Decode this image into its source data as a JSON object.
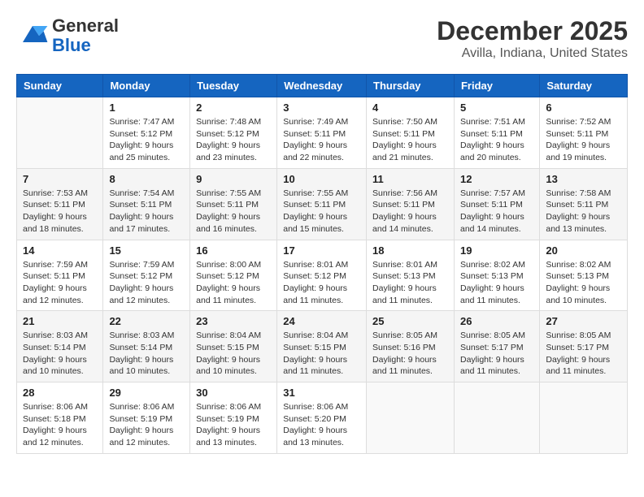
{
  "logo": {
    "line1": "General",
    "line2": "Blue"
  },
  "header": {
    "month": "December 2025",
    "location": "Avilla, Indiana, United States"
  },
  "days_of_week": [
    "Sunday",
    "Monday",
    "Tuesday",
    "Wednesday",
    "Thursday",
    "Friday",
    "Saturday"
  ],
  "weeks": [
    [
      {
        "day": "",
        "sunrise": "",
        "sunset": "",
        "daylight": ""
      },
      {
        "day": "1",
        "sunrise": "Sunrise: 7:47 AM",
        "sunset": "Sunset: 5:12 PM",
        "daylight": "Daylight: 9 hours and 25 minutes."
      },
      {
        "day": "2",
        "sunrise": "Sunrise: 7:48 AM",
        "sunset": "Sunset: 5:12 PM",
        "daylight": "Daylight: 9 hours and 23 minutes."
      },
      {
        "day": "3",
        "sunrise": "Sunrise: 7:49 AM",
        "sunset": "Sunset: 5:11 PM",
        "daylight": "Daylight: 9 hours and 22 minutes."
      },
      {
        "day": "4",
        "sunrise": "Sunrise: 7:50 AM",
        "sunset": "Sunset: 5:11 PM",
        "daylight": "Daylight: 9 hours and 21 minutes."
      },
      {
        "day": "5",
        "sunrise": "Sunrise: 7:51 AM",
        "sunset": "Sunset: 5:11 PM",
        "daylight": "Daylight: 9 hours and 20 minutes."
      },
      {
        "day": "6",
        "sunrise": "Sunrise: 7:52 AM",
        "sunset": "Sunset: 5:11 PM",
        "daylight": "Daylight: 9 hours and 19 minutes."
      }
    ],
    [
      {
        "day": "7",
        "sunrise": "Sunrise: 7:53 AM",
        "sunset": "Sunset: 5:11 PM",
        "daylight": "Daylight: 9 hours and 18 minutes."
      },
      {
        "day": "8",
        "sunrise": "Sunrise: 7:54 AM",
        "sunset": "Sunset: 5:11 PM",
        "daylight": "Daylight: 9 hours and 17 minutes."
      },
      {
        "day": "9",
        "sunrise": "Sunrise: 7:55 AM",
        "sunset": "Sunset: 5:11 PM",
        "daylight": "Daylight: 9 hours and 16 minutes."
      },
      {
        "day": "10",
        "sunrise": "Sunrise: 7:55 AM",
        "sunset": "Sunset: 5:11 PM",
        "daylight": "Daylight: 9 hours and 15 minutes."
      },
      {
        "day": "11",
        "sunrise": "Sunrise: 7:56 AM",
        "sunset": "Sunset: 5:11 PM",
        "daylight": "Daylight: 9 hours and 14 minutes."
      },
      {
        "day": "12",
        "sunrise": "Sunrise: 7:57 AM",
        "sunset": "Sunset: 5:11 PM",
        "daylight": "Daylight: 9 hours and 14 minutes."
      },
      {
        "day": "13",
        "sunrise": "Sunrise: 7:58 AM",
        "sunset": "Sunset: 5:11 PM",
        "daylight": "Daylight: 9 hours and 13 minutes."
      }
    ],
    [
      {
        "day": "14",
        "sunrise": "Sunrise: 7:59 AM",
        "sunset": "Sunset: 5:11 PM",
        "daylight": "Daylight: 9 hours and 12 minutes."
      },
      {
        "day": "15",
        "sunrise": "Sunrise: 7:59 AM",
        "sunset": "Sunset: 5:12 PM",
        "daylight": "Daylight: 9 hours and 12 minutes."
      },
      {
        "day": "16",
        "sunrise": "Sunrise: 8:00 AM",
        "sunset": "Sunset: 5:12 PM",
        "daylight": "Daylight: 9 hours and 11 minutes."
      },
      {
        "day": "17",
        "sunrise": "Sunrise: 8:01 AM",
        "sunset": "Sunset: 5:12 PM",
        "daylight": "Daylight: 9 hours and 11 minutes."
      },
      {
        "day": "18",
        "sunrise": "Sunrise: 8:01 AM",
        "sunset": "Sunset: 5:13 PM",
        "daylight": "Daylight: 9 hours and 11 minutes."
      },
      {
        "day": "19",
        "sunrise": "Sunrise: 8:02 AM",
        "sunset": "Sunset: 5:13 PM",
        "daylight": "Daylight: 9 hours and 11 minutes."
      },
      {
        "day": "20",
        "sunrise": "Sunrise: 8:02 AM",
        "sunset": "Sunset: 5:13 PM",
        "daylight": "Daylight: 9 hours and 10 minutes."
      }
    ],
    [
      {
        "day": "21",
        "sunrise": "Sunrise: 8:03 AM",
        "sunset": "Sunset: 5:14 PM",
        "daylight": "Daylight: 9 hours and 10 minutes."
      },
      {
        "day": "22",
        "sunrise": "Sunrise: 8:03 AM",
        "sunset": "Sunset: 5:14 PM",
        "daylight": "Daylight: 9 hours and 10 minutes."
      },
      {
        "day": "23",
        "sunrise": "Sunrise: 8:04 AM",
        "sunset": "Sunset: 5:15 PM",
        "daylight": "Daylight: 9 hours and 10 minutes."
      },
      {
        "day": "24",
        "sunrise": "Sunrise: 8:04 AM",
        "sunset": "Sunset: 5:15 PM",
        "daylight": "Daylight: 9 hours and 11 minutes."
      },
      {
        "day": "25",
        "sunrise": "Sunrise: 8:05 AM",
        "sunset": "Sunset: 5:16 PM",
        "daylight": "Daylight: 9 hours and 11 minutes."
      },
      {
        "day": "26",
        "sunrise": "Sunrise: 8:05 AM",
        "sunset": "Sunset: 5:17 PM",
        "daylight": "Daylight: 9 hours and 11 minutes."
      },
      {
        "day": "27",
        "sunrise": "Sunrise: 8:05 AM",
        "sunset": "Sunset: 5:17 PM",
        "daylight": "Daylight: 9 hours and 11 minutes."
      }
    ],
    [
      {
        "day": "28",
        "sunrise": "Sunrise: 8:06 AM",
        "sunset": "Sunset: 5:18 PM",
        "daylight": "Daylight: 9 hours and 12 minutes."
      },
      {
        "day": "29",
        "sunrise": "Sunrise: 8:06 AM",
        "sunset": "Sunset: 5:19 PM",
        "daylight": "Daylight: 9 hours and 12 minutes."
      },
      {
        "day": "30",
        "sunrise": "Sunrise: 8:06 AM",
        "sunset": "Sunset: 5:19 PM",
        "daylight": "Daylight: 9 hours and 13 minutes."
      },
      {
        "day": "31",
        "sunrise": "Sunrise: 8:06 AM",
        "sunset": "Sunset: 5:20 PM",
        "daylight": "Daylight: 9 hours and 13 minutes."
      },
      {
        "day": "",
        "sunrise": "",
        "sunset": "",
        "daylight": ""
      },
      {
        "day": "",
        "sunrise": "",
        "sunset": "",
        "daylight": ""
      },
      {
        "day": "",
        "sunrise": "",
        "sunset": "",
        "daylight": ""
      }
    ]
  ]
}
